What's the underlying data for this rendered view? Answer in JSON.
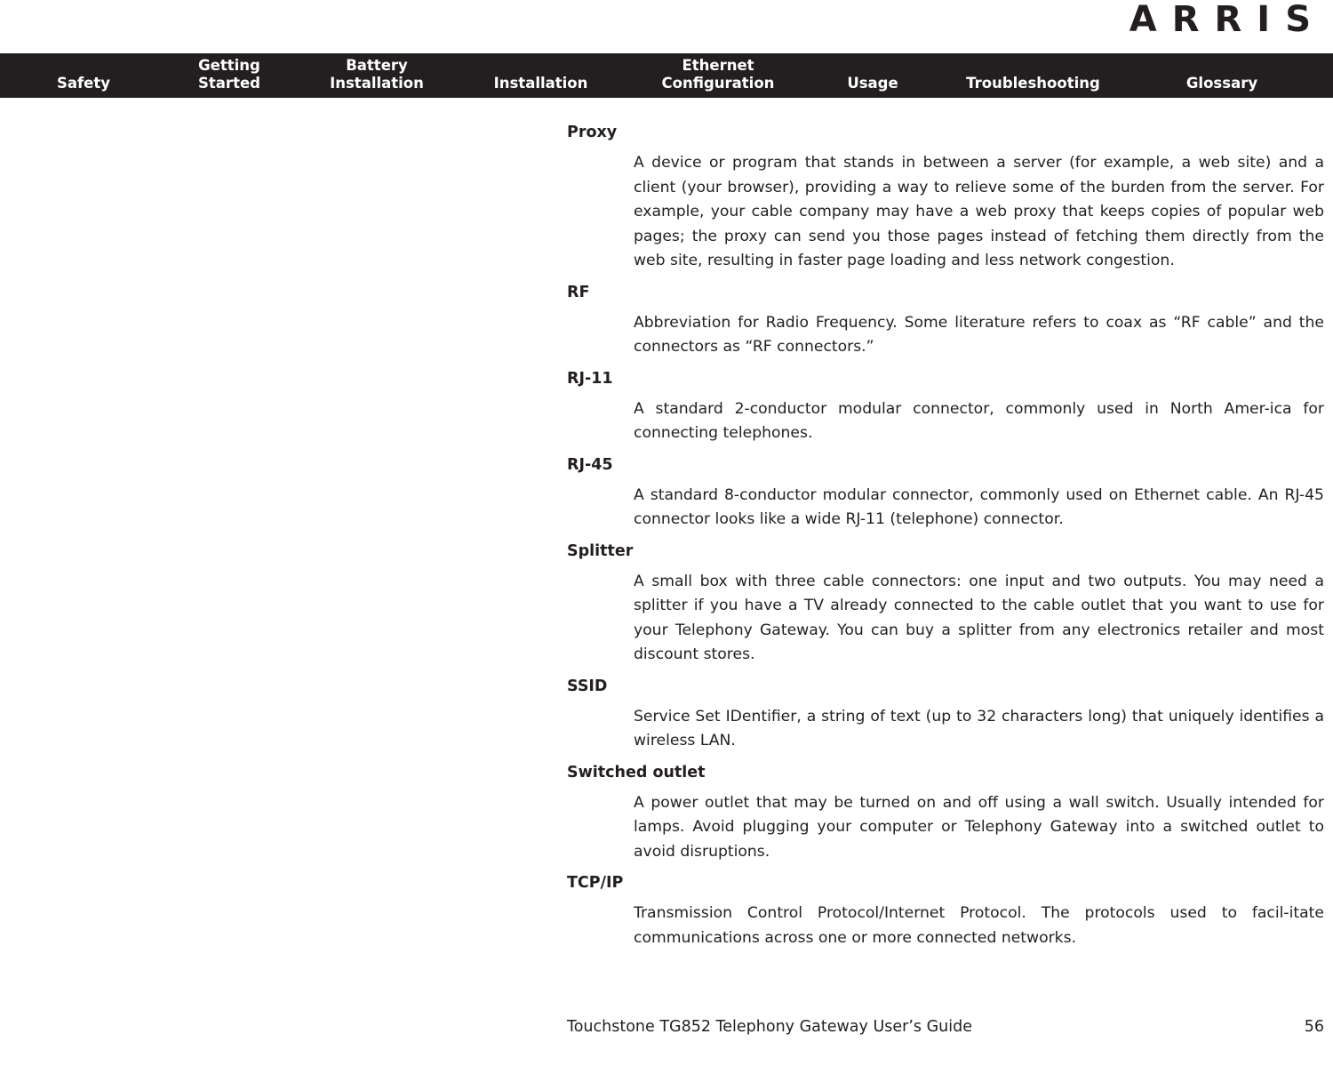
{
  "brand": {
    "logo_text": "ARRIS"
  },
  "nav": {
    "items": [
      {
        "label": "Safety",
        "key": "safety"
      },
      {
        "label": "Getting\nStarted",
        "key": "getting-started"
      },
      {
        "label": "Battery\nInstallation",
        "key": "battery-installation"
      },
      {
        "label": "Installation",
        "key": "installation"
      },
      {
        "label": "Ethernet\nConfiguration",
        "key": "ethernet-configuration"
      },
      {
        "label": "Usage",
        "key": "usage"
      },
      {
        "label": "Troubleshooting",
        "key": "troubleshooting"
      },
      {
        "label": "Glossary",
        "key": "glossary"
      }
    ],
    "background_color": "#231f20",
    "text_color": "#ffffff"
  },
  "glossary": {
    "entries": [
      {
        "term": "Proxy",
        "definition": "A device or program that stands in between a server (for example, a web site) and a client (your browser), providing a way to relieve some of the burden from the server. For example, your cable company may have a web proxy that keeps copies of popular web pages; the proxy can send you those pages instead of fetching them directly from the web site, resulting in faster page loading and less network congestion."
      },
      {
        "term": "RF",
        "definition": "Abbreviation for Radio Frequency. Some literature refers to coax as “RF cable” and the connectors as “RF connectors.”"
      },
      {
        "term": "RJ-11",
        "definition": "A standard 2-conductor modular connector, commonly used in North Amer-ica for connecting telephones."
      },
      {
        "term": "RJ-45",
        "definition": "A standard 8-conductor modular connector, commonly used on Ethernet cable. An RJ-45 connector looks like a wide RJ-11 (telephone) connector."
      },
      {
        "term": "Splitter",
        "definition": "A small box with three cable connectors: one input and two outputs. You may need a splitter if you have a TV already connected to the cable outlet that you want to use for your Telephony Gateway. You can buy a splitter from any electronics retailer and most discount stores."
      },
      {
        "term": "SSID",
        "definition": "Service Set IDentifier, a string of text (up to 32 characters long) that uniquely identifies a wireless LAN."
      },
      {
        "term": "Switched outlet",
        "definition": "A power outlet that may be turned on and off using a wall switch. Usually intended for lamps. Avoid plugging your computer or Telephony Gateway into a switched outlet to avoid disruptions."
      },
      {
        "term": "TCP/IP",
        "definition": "Transmission Control Protocol/Internet Protocol. The protocols used to facil-itate communications across one or more connected networks."
      }
    ]
  },
  "footer": {
    "title": "Touchstone TG852 Telephony Gateway User’s Guide",
    "page_number": "56"
  }
}
